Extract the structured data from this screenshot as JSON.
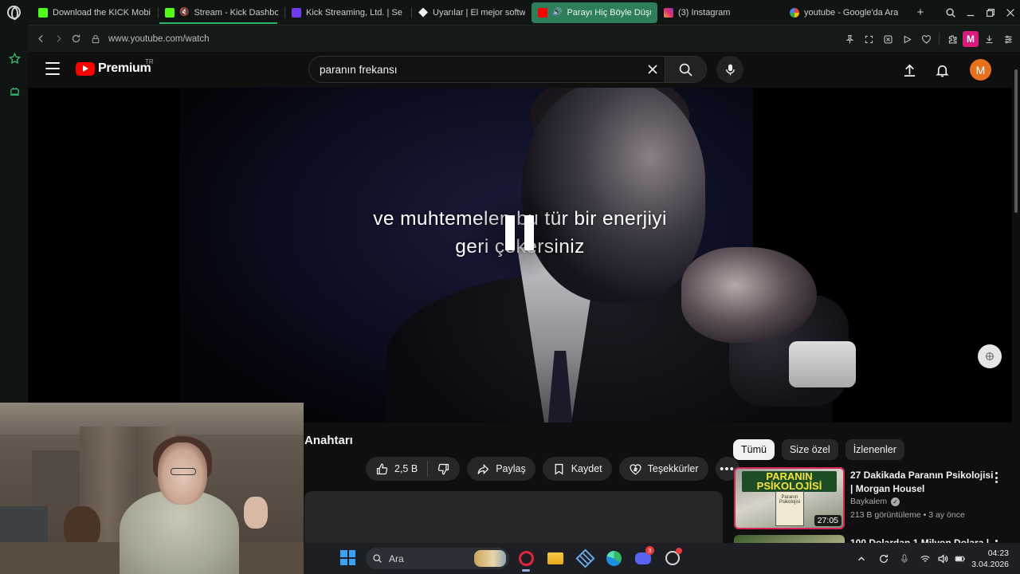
{
  "browser": {
    "tabs": [
      {
        "label": "Download the KICK Mobi",
        "favicon_color": "#53fc18"
      },
      {
        "label": "Stream - Kick Dashbo",
        "favicon_color": "#53fc18"
      },
      {
        "label": "Kick Streaming, Ltd. | Se",
        "favicon_color": "#6f3cf0"
      },
      {
        "label": "Uyarılar | El mejor softwa",
        "favicon_color": "#f0f0f0"
      },
      {
        "label": "Parayı Hiç Böyle Düşü",
        "favicon_color": "#ff0000",
        "active": true
      },
      {
        "label": "(3) Instagram",
        "favicon_color": "#e1306c"
      },
      {
        "label": "youtube - Google'da Ara",
        "favicon_color": "#4285f4"
      }
    ],
    "url": "www.youtube.com/watch",
    "profile_letter": "M"
  },
  "youtube": {
    "logo_text": "Premium",
    "region": "TR",
    "search_value": "paranın frekansı",
    "avatar_letter": "M",
    "subtitle_line1": "ve muhtemelen bu tür bir enerjiyi",
    "subtitle_line2": "geri çekersiniz",
    "video_title_fragment": "Anahtarı",
    "like_count": "2,5 B",
    "share_label": "Paylaş",
    "save_label": "Kaydet",
    "thanks_label": "Teşekkürler",
    "chips": [
      "Tümü",
      "Size özel",
      "İzlenenler"
    ],
    "recommendations": [
      {
        "title": "27 Dakikada Paranın Psikolojisi | Morgan Housel",
        "channel": "Baykalem",
        "views": "213 B görüntüleme",
        "age": "3 ay önce",
        "duration": "27:05",
        "thumb_title": "PARANIN PSİKOLOJİSİ",
        "thumb_book": "Paranın Psikolojisi"
      },
      {
        "title": "100 Dolardan 1 Milyon Dolara |"
      }
    ]
  },
  "taskbar": {
    "search_label": "Ara",
    "time": "04:23",
    "date": "3.04.2026",
    "discord_badge": "3"
  }
}
